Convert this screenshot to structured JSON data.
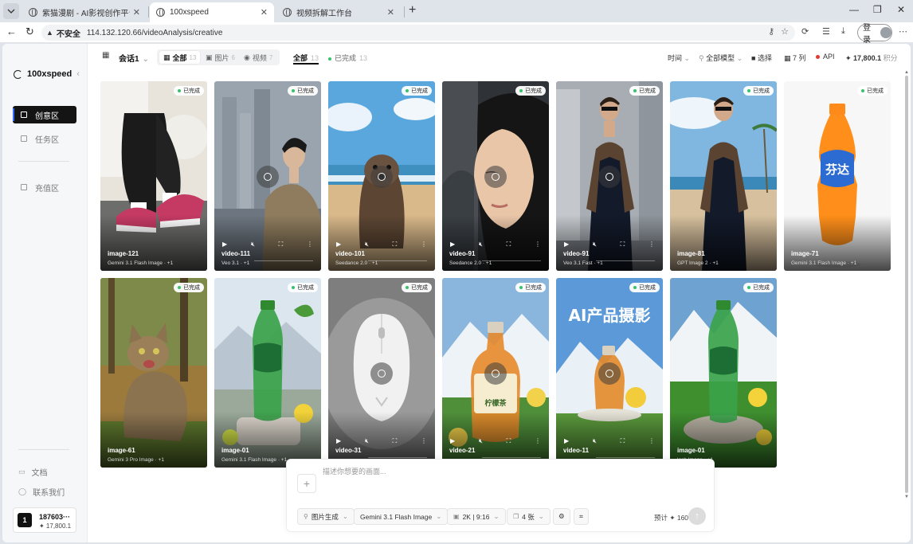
{
  "browser": {
    "tabs": [
      {
        "title": "紫猫漫剧 - AI影视创作平台",
        "active": false
      },
      {
        "title": "100xspeed",
        "active": true
      },
      {
        "title": "视频拆解工作台",
        "active": false
      }
    ],
    "address_label": "不安全",
    "url": "114.132.120.66/videoAnalysis/creative",
    "login_label": "登录"
  },
  "sidebar": {
    "brand": "100xspeed",
    "items": [
      {
        "label": "创意区",
        "active": true
      },
      {
        "label": "任务区",
        "active": false
      },
      {
        "label": "充值区",
        "active": false
      }
    ],
    "bottom": [
      {
        "label": "文档"
      },
      {
        "label": "联系我们"
      }
    ],
    "user": {
      "initial": "1",
      "name": "187603···",
      "points": "✦ 17,800.1"
    }
  },
  "toolbar": {
    "session": "会话1",
    "type_tabs": [
      {
        "label": "全部",
        "count": "13",
        "active": true
      },
      {
        "label": "图片",
        "count": "6",
        "active": false
      },
      {
        "label": "视频",
        "count": "7",
        "active": false
      }
    ],
    "status_filters": [
      {
        "label": "全部",
        "count": "13",
        "active": true
      },
      {
        "label": "已完成",
        "count": "13",
        "active": false
      }
    ],
    "time": "时间",
    "models": "全部模型",
    "select": "选择",
    "columns": "7 列",
    "api": "API",
    "points": "17,800.1",
    "points_unit": "积分"
  },
  "cards": [
    {
      "name": "image-121",
      "model": "Gemini 3.1 Flash Image",
      "extra": "+1",
      "status": "已完成",
      "kind": "image",
      "scene": "sneakers"
    },
    {
      "name": "video-111",
      "model": "Veo 3.1",
      "extra": "+1",
      "status": "已完成",
      "kind": "video",
      "scene": "city-man"
    },
    {
      "name": "video-101",
      "model": "Seedance 2.0",
      "extra": "+1",
      "status": "已完成",
      "kind": "video",
      "scene": "sealion"
    },
    {
      "name": "video-91",
      "model": "Seedance 2.0",
      "extra": "+1",
      "status": "已完成",
      "kind": "video",
      "scene": "woman"
    },
    {
      "name": "video-91",
      "model": "Veo 3.1 Fast",
      "extra": "+1",
      "status": "已完成",
      "kind": "video",
      "scene": "suit-city"
    },
    {
      "name": "image-81",
      "model": "GPT Image 2",
      "extra": "+1",
      "status": "已完成",
      "kind": "image",
      "scene": "suit-beach"
    },
    {
      "name": "image-71",
      "model": "Gemini 3.1 Flash Image",
      "extra": "+1",
      "status": "已完成",
      "kind": "image",
      "scene": "fanta",
      "bottle_text": "芬达"
    },
    {
      "name": "image-61",
      "model": "Gemini 3 Pro Image",
      "extra": "+1",
      "status": "已完成",
      "kind": "image",
      "scene": "cat"
    },
    {
      "name": "image-01",
      "model": "Gemini 3.1 Flash Image",
      "extra": "+1",
      "status": "已完成",
      "kind": "image",
      "scene": "sprite-rock"
    },
    {
      "name": "video-31",
      "model": "",
      "extra": "",
      "status": "已完成",
      "kind": "video",
      "scene": "mouse"
    },
    {
      "name": "video-21",
      "model": "",
      "extra": "",
      "status": "已完成",
      "kind": "video",
      "scene": "tea",
      "bottle_text": "柠檬茶"
    },
    {
      "name": "video-11",
      "model": "",
      "extra": "",
      "status": "已完成",
      "kind": "video",
      "scene": "ai-product",
      "headline": "AI产品摄影"
    },
    {
      "name": "image-01",
      "model": "lash Image",
      "extra": "+1",
      "status": "已完成",
      "kind": "image",
      "scene": "sprite-grass"
    }
  ],
  "composer": {
    "placeholder": "描述你想要的画面...",
    "mode": "图片生成",
    "model": "Gemini 3.1 Flash Image",
    "resolution": "2K | 9:16",
    "count": "4 张",
    "estimate": "预计 ✦ 160"
  }
}
